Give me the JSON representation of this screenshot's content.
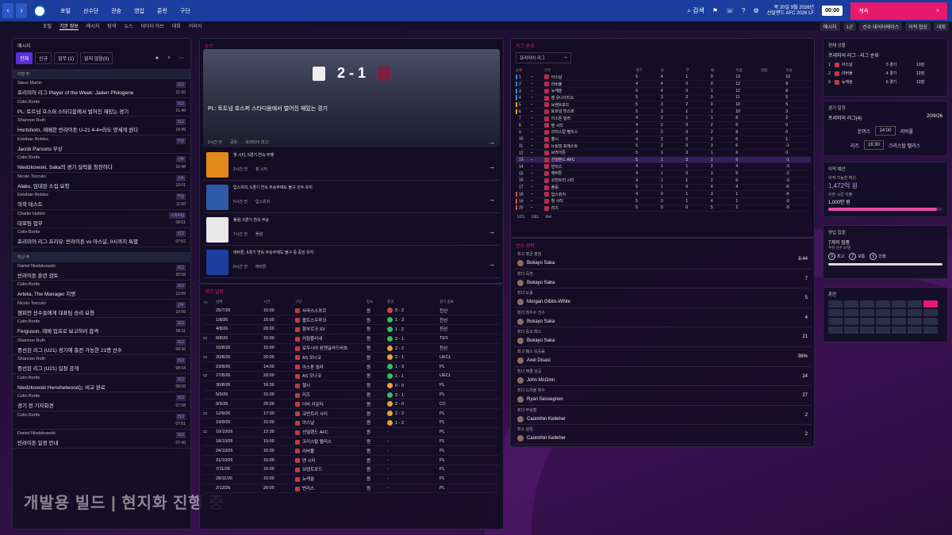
{
  "topbar": {
    "menu": [
      "포털",
      "선수단",
      "관숭",
      "영입",
      "훈련",
      "구단"
    ],
    "right_labels": [
      "검색",
      "",
      "",
      "",
      ""
    ],
    "date_line1": "목 20일 9월 2026년",
    "date_line2": "선덜랜드 AFC 2026 LF",
    "time": "00:00",
    "continue": "계속"
  },
  "subbar": {
    "tabs": [
      "포털",
      "기본 정보",
      "메시지",
      "탐색",
      "뉴스",
      "데이터 허브",
      "대회",
      "커리어"
    ],
    "active": 1,
    "right_buttons": [
      "메시지",
      "1군",
      "선수 데이터베이스",
      "이적 협상",
      "대회"
    ]
  },
  "messages": {
    "title": "메시지",
    "tabs": [
      "전체",
      "신규",
      "업무 (1)",
      "읽지 않음(0)"
    ],
    "groups": [
      {
        "label": "이번 주",
        "items": [
          {
            "sender": "Steve Martin",
            "text": "프리미어 리그 Player of the Week: Jaden Philogene",
            "time": "21:50",
            "tag": "리그"
          },
          {
            "sender": "Colin Bortle",
            "text": "PL: 토트넘 호스퍼 스타디움에서 벌어진 재밌는 경기",
            "time": "21:46",
            "tag": "리그"
          },
          {
            "sender": "Shannon Ruth",
            "text": "Hortshorn, 레메한 빈라이튼 U-21 4-4=라도 양세게 원다",
            "time": "16:45",
            "tag": "리그"
          },
          {
            "sender": "Esteban Robles",
            "text": "Jacob Parsons 부상",
            "time": "",
            "tag": "부상"
          },
          {
            "sender": "Colin Bortle",
            "text": "Niedzkowski, Saka의 경기 실력을 칭찬하다",
            "time": "16:48",
            "tag": "선수"
          },
          {
            "sender": "Nicolo Toccuto",
            "text": "Alaku, 임대된 소집 요청",
            "time": "12:01",
            "tag": "선수"
          },
          {
            "sender": "Esteban Robles",
            "text": "의학 테스트",
            "time": "11:50",
            "tag": "부상"
          },
          {
            "sender": "Charlie Hutton",
            "text": "대표팀 업무",
            "time": "08:51",
            "tag": "스카우팅"
          },
          {
            "sender": "Colin Bortle",
            "text": "프리미어 리그 프리뷰: 빈라이튼 vs 아스널, 0시까지 특별",
            "time": "07:52",
            "tag": "리그"
          }
        ]
      },
      {
        "label": "지난 주",
        "items": [
          {
            "sender": "Daniel Niedzkowski",
            "text": "빈라이튼 훈련 검토",
            "time": "20:58",
            "tag": "리그"
          },
          {
            "sender": "Colin Bortle",
            "text": "Arteta, The Manager 지명",
            "time": "12:09",
            "tag": "리그"
          },
          {
            "sender": "Nicolo Toccuto",
            "text": "챔피언 선수들에게 대표팀 승리 요청",
            "time": "10:56",
            "tag": "선수"
          },
          {
            "sender": "Colin Bortle",
            "text": "Ferguson, 레메 입프로 보고하러 합격",
            "time": "09:11",
            "tag": "리그"
          },
          {
            "sender": "Shannon Ruth",
            "text": "중선된 리그 (U21) 경기에 출전 가능한 21명 선수",
            "time": "08:36",
            "tag": "리그"
          },
          {
            "sender": "Shannon Ruth",
            "text": "중선된 리그 (U21) 일정 공개",
            "time": "08:34",
            "tag": "리그"
          },
          {
            "sender": "Colin Bortle",
            "text": "Niedzkowski Henshelwood는 비교 완료",
            "time": "08:06",
            "tag": "리그"
          },
          {
            "sender": "Colin Bortle",
            "text": "경기 전 기자회견",
            "time": "07:58",
            "tag": "리그"
          },
          {
            "sender": "Colin Bortle",
            "text": "",
            "time": "07:51",
            "tag": "리그"
          },
          {
            "sender": "Daniel Niedzkowski",
            "text": "빈라이튼 일정 안내",
            "time": "07:46",
            "tag": "리그"
          }
        ]
      }
    ]
  },
  "watermark": "개발용 빌드 | 현지화 진행 중",
  "news": {
    "title": "뉴스",
    "big": {
      "home_score": "2",
      "away_score": "1",
      "headline": "PL: 토트넘 호스퍼 스타디움에서 벌어진 재밌는 경기",
      "meta": [
        "2시간 전",
        "공유",
        "프리미어 리그"
      ]
    },
    "list": [
      {
        "title": "헐 시티, 5경기 연속 무패",
        "time": "2시간 전",
        "club": "헐 시티",
        "color": "#e48a1a"
      },
      {
        "title": "입스위치, 5경기 연속 무승부에도 불구 선두 유지",
        "time": "5시간 전",
        "club": "입스위치",
        "color": "#2e5aa8"
      },
      {
        "title": "풀럼, 5경기 연속 무승",
        "time": "7시간 전",
        "club": "풀럼",
        "color": "#e8e8e8"
      },
      {
        "title": "에버튼, 5경기 연속 무승부에도 불구 중 중앙 유지",
        "time": "8시간 전",
        "club": "에버튼",
        "color": "#1a3d9e"
      }
    ]
  },
  "fixtures": {
    "title": "경기 일정",
    "headers": [
      "TV",
      "날짜",
      "시간",
      "구단",
      "장소",
      "결과",
      "경기 종류"
    ],
    "rows": [
      {
        "tv": "",
        "date": "25/7/26",
        "time": "15:00",
        "team": "사라스스포르",
        "venue": "원",
        "result": "0 - 2",
        "res": "L",
        "comp": "친선"
      },
      {
        "tv": "",
        "date": "1/8/26",
        "time": "15:00",
        "team": "볼트스우루크",
        "venue": "원",
        "result": "1 - 3",
        "res": "W",
        "comp": "친선"
      },
      {
        "tv": "",
        "date": "4/8/26",
        "time": "20:00",
        "team": "함부르크 SV",
        "venue": "원",
        "result": "1 - 2",
        "res": "W",
        "comp": "친선"
      },
      {
        "tv": "tv",
        "date": "8/8/26",
        "time": "15:00",
        "team": "커힘플리네",
        "venue": "원",
        "result": "2 - 1",
        "res": "W",
        "comp": "TES"
      },
      {
        "tv": "",
        "date": "15/8/26",
        "time": "15:00",
        "team": "로우시아 묀헨글라드바흐",
        "venue": "원",
        "result": "2 - 2",
        "res": "D",
        "comp": "친선"
      },
      {
        "tv": "tv",
        "date": "20/8/26",
        "time": "20:00",
        "team": "AS 모나코",
        "venue": "원",
        "result": "2 - 1",
        "res": "D",
        "comp": "UECL"
      },
      {
        "tv": "",
        "date": "23/8/26",
        "time": "14:00",
        "team": "아스톤 빌라",
        "venue": "원",
        "result": "1 - 3",
        "res": "W",
        "comp": "PL"
      },
      {
        "tv": "tv",
        "date": "27/8/26",
        "time": "20:00",
        "team": "AS 모나코",
        "venue": "원",
        "result": "1 - 1",
        "res": "W",
        "comp": "UECL"
      },
      {
        "tv": "",
        "date": "30/8/26",
        "time": "16:30",
        "team": "첼시",
        "venue": "원",
        "result": "0 - 0",
        "res": "D",
        "comp": "PL"
      },
      {
        "tv": "",
        "date": "5/9/26",
        "time": "15:00",
        "team": "리즈",
        "venue": "원",
        "result": "3 - 1",
        "res": "W",
        "comp": "PL"
      },
      {
        "tv": "",
        "date": "9/9/26",
        "time": "20:00",
        "team": "더비 카운티",
        "venue": "원",
        "result": "2 - 0",
        "res": "D",
        "comp": "CC"
      },
      {
        "tv": "tv",
        "date": "12/9/26",
        "time": "17:30",
        "team": "코번트리 시티",
        "venue": "원",
        "result": "2 - 2",
        "res": "D",
        "comp": "PL"
      },
      {
        "tv": "",
        "date": "19/9/26",
        "time": "15:00",
        "team": "아스날",
        "venue": "원",
        "result": "1 - 2",
        "res": "D",
        "comp": "PL"
      },
      {
        "tv": "tv",
        "date": "10/10/26",
        "time": "12:30",
        "team": "선덜랜드 AFC",
        "venue": "원",
        "result": "-",
        "res": "",
        "comp": "PL"
      },
      {
        "tv": "",
        "date": "18/10/26",
        "time": "15:00",
        "team": "크리스탈 팰리스",
        "venue": "원",
        "result": "-",
        "res": "",
        "comp": "PL"
      },
      {
        "tv": "",
        "date": "24/10/26",
        "time": "15:00",
        "team": "리버풀",
        "venue": "원",
        "result": "-",
        "res": "",
        "comp": "PL"
      },
      {
        "tv": "",
        "date": "31/10/26",
        "time": "15:00",
        "team": "맨 시티",
        "venue": "원",
        "result": "-",
        "res": "",
        "comp": "PL"
      },
      {
        "tv": "",
        "date": "7/11/26",
        "time": "15:00",
        "team": "브렌트포드",
        "venue": "원",
        "result": "-",
        "res": "",
        "comp": "PL"
      },
      {
        "tv": "",
        "date": "28/11/26",
        "time": "15:00",
        "team": "뉴캐슬",
        "venue": "원",
        "result": "-",
        "res": "",
        "comp": "PL"
      },
      {
        "tv": "",
        "date": "2/12/26",
        "time": "20:00",
        "team": "번리스",
        "venue": "원",
        "result": "-",
        "res": "",
        "comp": "PL"
      }
    ]
  },
  "league": {
    "title": "리그 순위",
    "select": "프리미어 리그",
    "headers": [
      "순위",
      "",
      "구단",
      "경기",
      "승",
      "무",
      "패",
      "득점",
      "실점",
      "득실"
    ],
    "rows": [
      {
        "pos": "1",
        "team": "아스날",
        "p": "5",
        "w": "4",
        "d": "1",
        "l": "0",
        "gf": "13",
        "ga": "",
        "gd": "10"
      },
      {
        "pos": "2",
        "team": "리버풀",
        "p": "4",
        "w": "4",
        "d": "0",
        "l": "0",
        "gf": "12",
        "ga": "",
        "gd": "8"
      },
      {
        "pos": "3",
        "team": "뉴캐슬",
        "p": "5",
        "w": "4",
        "d": "0",
        "l": "1",
        "gf": "12",
        "ga": "",
        "gd": "8"
      },
      {
        "pos": "4",
        "team": "맨 유나이티드",
        "p": "5",
        "w": "3",
        "d": "2",
        "l": "0",
        "gf": "11",
        "ga": "",
        "gd": "5"
      },
      {
        "pos": "5",
        "team": "브렌트포드",
        "p": "5",
        "w": "3",
        "d": "2",
        "l": "0",
        "gf": "10",
        "ga": "",
        "gd": "5"
      },
      {
        "pos": "6",
        "team": "토트넘 핫스퍼",
        "p": "5",
        "w": "3",
        "d": "1",
        "l": "1",
        "gf": "10",
        "ga": "",
        "gd": "3"
      },
      {
        "pos": "7",
        "team": "아스톤 빌라",
        "p": "4",
        "w": "2",
        "d": "1",
        "l": "1",
        "gf": "8",
        "ga": "",
        "gd": "2"
      },
      {
        "pos": "8",
        "team": "맨 시티",
        "p": "4",
        "w": "2",
        "d": "0",
        "l": "2",
        "gf": "6",
        "ga": "",
        "gd": "0"
      },
      {
        "pos": "9",
        "team": "크리스탈 팰리스",
        "p": "4",
        "w": "2",
        "d": "0",
        "l": "2",
        "gf": "8",
        "ga": "",
        "gd": "0"
      },
      {
        "pos": "10",
        "team": "첼시",
        "p": "4",
        "w": "2",
        "d": "0",
        "l": "2",
        "gf": "6",
        "ga": "",
        "gd": "1"
      },
      {
        "pos": "11",
        "team": "노팅엄 포레스트",
        "p": "5",
        "w": "2",
        "d": "0",
        "l": "3",
        "gf": "6",
        "ga": "",
        "gd": "-1"
      },
      {
        "pos": "12",
        "team": "브라이튼",
        "p": "5",
        "w": "1",
        "d": "3",
        "l": "1",
        "gf": "6",
        "ga": "",
        "gd": "0"
      },
      {
        "pos": "13",
        "team": "선덜랜드 AFC",
        "p": "5",
        "w": "1",
        "d": "3",
        "l": "1",
        "gf": "6",
        "ga": "",
        "gd": "-1"
      },
      {
        "pos": "14",
        "team": "번리스",
        "p": "4",
        "w": "1",
        "d": "1",
        "l": "2",
        "gf": "4",
        "ga": "",
        "gd": "-3"
      },
      {
        "pos": "15",
        "team": "에버튼",
        "p": "4",
        "w": "1",
        "d": "0",
        "l": "3",
        "gf": "5",
        "ga": "",
        "gd": "-2"
      },
      {
        "pos": "16",
        "team": "코번트리 시티",
        "p": "4",
        "w": "1",
        "d": "1",
        "l": "2",
        "gf": "6",
        "ga": "",
        "gd": "-3"
      },
      {
        "pos": "17",
        "team": "풀럼",
        "p": "5",
        "w": "1",
        "d": "0",
        "l": "4",
        "gf": "4",
        "ga": "",
        "gd": "-6"
      },
      {
        "pos": "18",
        "team": "입스위치",
        "p": "4",
        "w": "0",
        "d": "1",
        "l": "3",
        "gf": "1",
        "ga": "",
        "gd": "-6"
      },
      {
        "pos": "19",
        "team": "헐 시티",
        "p": "5",
        "w": "0",
        "d": "1",
        "l": "4",
        "gf": "1",
        "ga": "",
        "gd": "-9"
      },
      {
        "pos": "20",
        "team": "리즈",
        "p": "5",
        "w": "0",
        "d": "0",
        "l": "5",
        "gf": "2",
        "ga": "",
        "gd": "-9"
      }
    ],
    "legend": [
      "UCL",
      "UEL",
      "Rel"
    ]
  },
  "stats": {
    "title": "선수 성적",
    "rows": [
      {
        "label": "최고 평균 평점",
        "player": "Bukayo Saka",
        "value": "8.44"
      },
      {
        "label": "최다 득점",
        "player": "Bukayo Saka",
        "value": "7"
      },
      {
        "label": "최다 도움",
        "player": "Morgan Gibbs-White",
        "value": "5"
      },
      {
        "label": "최다 최우수 선수",
        "player": "Bukayo Saka",
        "value": "4"
      },
      {
        "label": "최다 중요 패스",
        "player": "Bukayo Saka",
        "value": "21"
      },
      {
        "label": "최고 패스 성공률",
        "player": "Axel Disasi",
        "value": "98%"
      },
      {
        "label": "최다 태클 성공",
        "player": "John McGinn",
        "value": "14"
      },
      {
        "label": "최다 드리블 횟수",
        "player": "Ryan Sessegnon",
        "value": "27"
      },
      {
        "label": "최다 무실점",
        "player": "Caoimhin Kelleher",
        "value": "2"
      },
      {
        "label": "최소 실점",
        "player": "Caoimhin Kelleher",
        "value": "2"
      }
    ]
  },
  "right": {
    "status_title": "현재 상황",
    "status_sub": "프리미어 리그 - 리그 순위",
    "status_rows": [
      {
        "pos": "1",
        "team": "아스날",
        "games": "5 경기",
        "pts": "13점"
      },
      {
        "pos": "2",
        "team": "리버풀",
        "games": "4 경기",
        "pts": "12점"
      },
      {
        "pos": "3",
        "team": "뉴캐슬",
        "games": "5 경기",
        "pts": "12점"
      }
    ],
    "fixture_title": "경기 일정",
    "fixture_comp": "프리미어 리그(4)",
    "fixture_date": "20/9/26",
    "fixture_rows": [
      {
        "home": "본머스",
        "time": "14:00",
        "away": "리버풀"
      },
      {
        "home": "리즈",
        "time": "16:30",
        "away": "크리스탈 팰리스"
      }
    ],
    "budget_title": "이적 예산",
    "budget_label": "이적 가능한 예산",
    "budget_value": "1,472억 원",
    "wage_label": "이번 시즌 지출",
    "wage_value": "1,000만 원",
    "budget_fill": 0.95,
    "scout_title": "영입 집중",
    "scout_value": "7개의 집중",
    "scout_sub": "추천 선수 37명",
    "scout_badges": [
      {
        "n": "0",
        "l": "최고"
      },
      {
        "n": "2",
        "l": "보통"
      },
      {
        "n": "5",
        "l": "진행"
      }
    ],
    "training_title": "훈련"
  }
}
